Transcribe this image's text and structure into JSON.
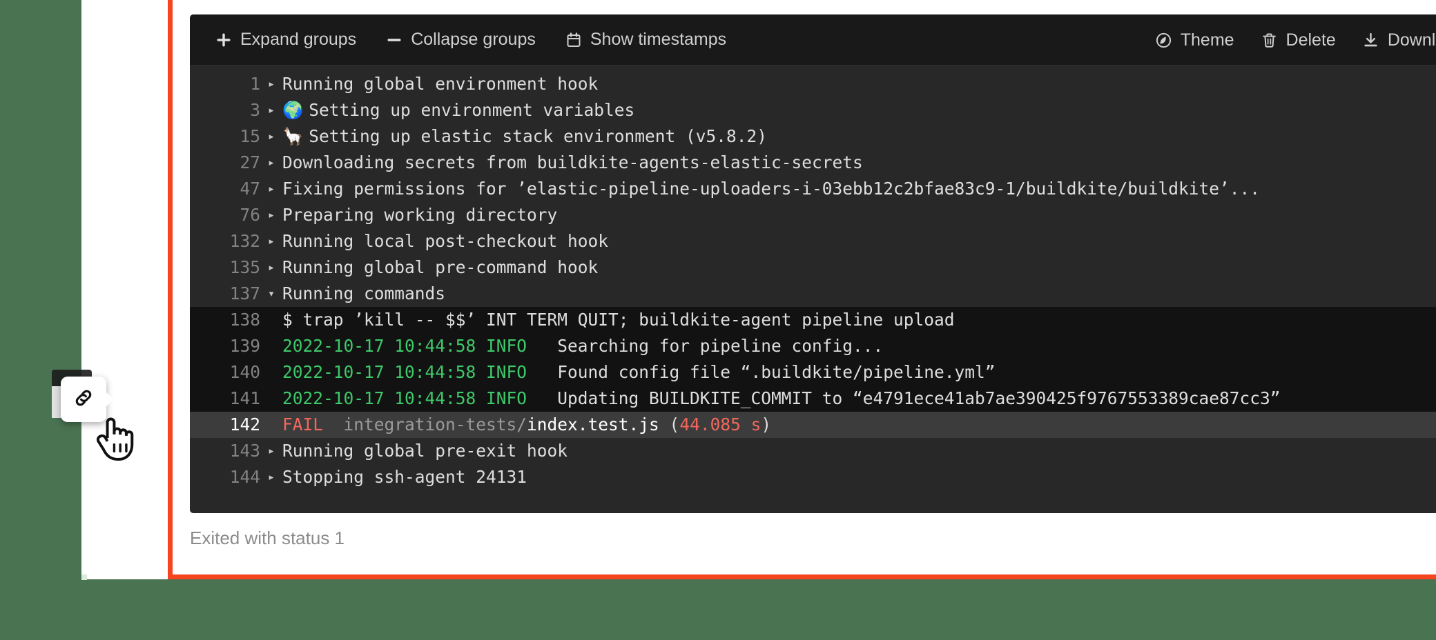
{
  "theme": {
    "page_background": "#4a7352",
    "card_background": "#ffffff",
    "accent_rule": "#f4451f",
    "toolbar_background": "#191919",
    "log_background": "#282828",
    "group_content_background": "#121212",
    "highlight_background": "#3c3c3c",
    "info_green": "#3ec96a",
    "fail_red": "#f2675d"
  },
  "toolbar": {
    "left_buttons": [
      {
        "icon": "plus-icon",
        "label": "Expand groups"
      },
      {
        "icon": "minus-icon",
        "label": "Collapse groups"
      },
      {
        "icon": "calendar-icon",
        "label": "Show timestamps"
      }
    ],
    "right_buttons": [
      {
        "icon": "theme-icon",
        "label": "Theme"
      },
      {
        "icon": "trash-icon",
        "label": "Delete"
      },
      {
        "icon": "download-icon",
        "label": "Download"
      },
      {
        "icon": "file-icon",
        "label": ""
      }
    ]
  },
  "log": {
    "rows": [
      {
        "line": "1",
        "caret": "collapsed",
        "style": "normal",
        "segments": [
          {
            "text": "Running global environment hook",
            "cls": "t-plain"
          }
        ]
      },
      {
        "line": "3",
        "caret": "collapsed",
        "style": "normal",
        "segments": [
          {
            "text": "🌍 ",
            "cls": "emoji"
          },
          {
            "text": "Setting up environment variables",
            "cls": "t-plain"
          }
        ]
      },
      {
        "line": "15",
        "caret": "collapsed",
        "style": "normal",
        "segments": [
          {
            "text": "🦙 ",
            "cls": "emoji"
          },
          {
            "text": "Setting up elastic stack environment (v5.8.2)",
            "cls": "t-plain"
          }
        ]
      },
      {
        "line": "27",
        "caret": "collapsed",
        "style": "normal",
        "segments": [
          {
            "text": "Downloading secrets from buildkite-agents-elastic-secrets",
            "cls": "t-plain"
          }
        ]
      },
      {
        "line": "47",
        "caret": "collapsed",
        "style": "normal",
        "segments": [
          {
            "text": "Fixing permissions for ’elastic-pipeline-uploaders-i-03ebb12c2bfae83c9-1/buildkite/buildkite’...",
            "cls": "t-plain"
          }
        ]
      },
      {
        "line": "76",
        "caret": "collapsed",
        "style": "normal",
        "segments": [
          {
            "text": "Preparing working directory",
            "cls": "t-plain"
          }
        ]
      },
      {
        "line": "132",
        "caret": "collapsed",
        "style": "normal",
        "segments": [
          {
            "text": "Running local post-checkout hook",
            "cls": "t-plain"
          }
        ]
      },
      {
        "line": "135",
        "caret": "collapsed",
        "style": "normal",
        "segments": [
          {
            "text": "Running global pre-command hook",
            "cls": "t-plain"
          }
        ]
      },
      {
        "line": "137",
        "caret": "expanded",
        "style": "normal",
        "segments": [
          {
            "text": "Running commands",
            "cls": "t-plain"
          }
        ]
      },
      {
        "line": "138",
        "caret": "none",
        "style": "group-content",
        "segments": [
          {
            "text": "$ trap ’kill -- $$’ INT TERM QUIT; buildkite-agent pipeline upload",
            "cls": "t-plain"
          }
        ]
      },
      {
        "line": "139",
        "caret": "none",
        "style": "group-content",
        "segments": [
          {
            "text": "2022-10-17 10:44:58 INFO",
            "cls": "t-green"
          },
          {
            "text": "   Searching for pipeline config...",
            "cls": "t-plain"
          }
        ]
      },
      {
        "line": "140",
        "caret": "none",
        "style": "group-content",
        "segments": [
          {
            "text": "2022-10-17 10:44:58 INFO",
            "cls": "t-green"
          },
          {
            "text": "   Found config file “.buildkite/pipeline.yml”",
            "cls": "t-plain"
          }
        ]
      },
      {
        "line": "141",
        "caret": "none",
        "style": "group-content",
        "segments": [
          {
            "text": "2022-10-17 10:44:58 INFO",
            "cls": "t-green"
          },
          {
            "text": "   Updating BUILDKITE_COMMIT to “e4791ece41ab7ae390425f9767553389cae87cc3”",
            "cls": "t-plain"
          }
        ]
      },
      {
        "line": "142",
        "caret": "none",
        "style": "highlighted",
        "segments": [
          {
            "text": "FAIL",
            "cls": "t-red"
          },
          {
            "text": "  integration-tests/",
            "cls": "t-dim"
          },
          {
            "text": "index.test.js",
            "cls": "t-white"
          },
          {
            "text": " (",
            "cls": "t-plain"
          },
          {
            "text": "44.085 s",
            "cls": "t-red"
          },
          {
            "text": ")",
            "cls": "t-plain"
          }
        ]
      },
      {
        "line": "143",
        "caret": "collapsed",
        "style": "normal",
        "segments": [
          {
            "text": "Running global pre-exit hook",
            "cls": "t-plain"
          }
        ]
      },
      {
        "line": "144",
        "caret": "collapsed",
        "style": "normal",
        "segments": [
          {
            "text": "Stopping ssh-agent 24131",
            "cls": "t-plain"
          }
        ]
      }
    ]
  },
  "status": {
    "exit_text": "Exited with status 1"
  },
  "overlay": {
    "tooltip_icon": "link-icon",
    "cursor": "pointer-hand-cursor"
  }
}
